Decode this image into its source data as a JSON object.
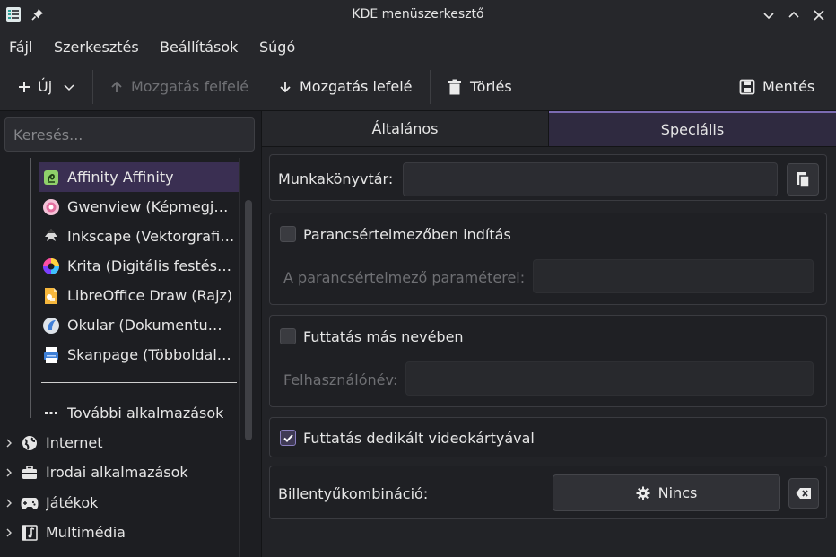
{
  "window": {
    "title": "KDE menüszerkesztő"
  },
  "menubar": {
    "items": [
      "Fájl",
      "Szerkesztés",
      "Beállítások",
      "Súgó"
    ]
  },
  "toolbar": {
    "new_label": "Új",
    "move_up_label": "Mozgatás felfelé",
    "move_down_label": "Mozgatás lefelé",
    "delete_label": "Törlés",
    "save_label": "Mentés"
  },
  "search": {
    "placeholder": "Keresés..."
  },
  "tree": {
    "apps": [
      {
        "label": "Affinity Affinity",
        "icon": "affinity-icon",
        "selected": true
      },
      {
        "label": "Gwenview (Képmegjelenítő)",
        "icon": "gwenview-icon"
      },
      {
        "label": "Inkscape (Vektorgrafikus szerkesztő)",
        "icon": "inkscape-icon"
      },
      {
        "label": "Krita (Digitális festészet)",
        "icon": "krita-icon"
      },
      {
        "label": "LibreOffice Draw (Rajz)",
        "icon": "libreoffice-draw-icon"
      },
      {
        "label": "Okular (Dokumentummegjelenítő)",
        "icon": "okular-icon"
      },
      {
        "label": "Skanpage (Többoldalas szkennelés)",
        "icon": "skanpage-icon"
      }
    ],
    "more_label": "További alkalmazások",
    "categories": [
      {
        "label": "Internet",
        "icon": "globe-icon"
      },
      {
        "label": "Irodai alkalmazások",
        "icon": "briefcase-icon"
      },
      {
        "label": "Játékok",
        "icon": "gamepad-icon"
      },
      {
        "label": "Multimédia",
        "icon": "multimedia-icon"
      }
    ]
  },
  "tabs": {
    "general": "Általános",
    "advanced": "Speciális",
    "active": "Speciális"
  },
  "advanced": {
    "workdir_label": "Munkakönyvtár:",
    "workdir_value": "",
    "terminal_label": "Parancsértelmezőben indítás",
    "terminal_checked": false,
    "terminal_params_label": "A parancsértelmező paraméterei:",
    "terminal_params_value": "",
    "runas_label": "Futtatás más nevében",
    "runas_checked": false,
    "username_label": "Felhasználónév:",
    "username_value": "",
    "gpu_label": "Futtatás dedikált videokártyával",
    "gpu_checked": true,
    "shortcut_label": "Billentyűkombináció:",
    "shortcut_value": "Nincs"
  },
  "colors": {
    "accent": "#7b6bb2",
    "selection": "#3a2f52"
  }
}
